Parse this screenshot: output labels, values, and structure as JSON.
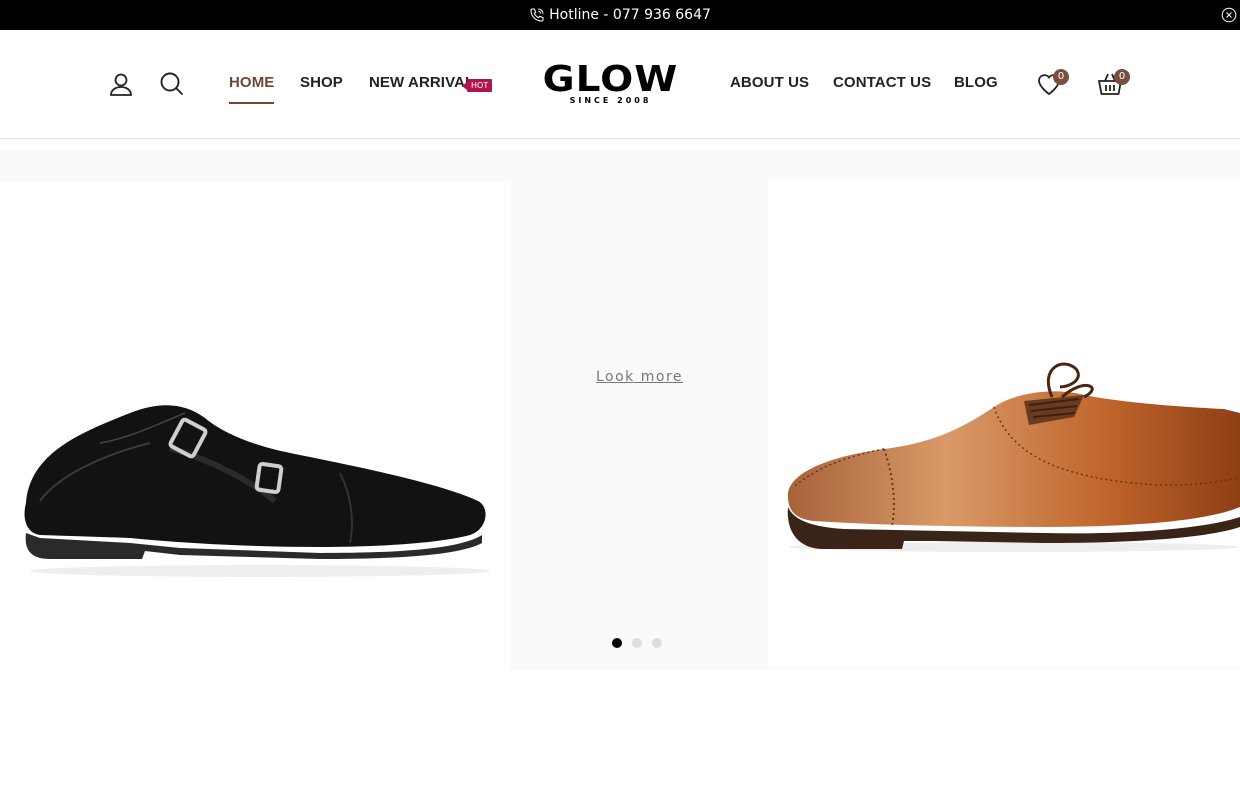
{
  "topbar": {
    "hotline_text": "Hotline - 077 936 6647",
    "phone_icon": "phone-icon",
    "close_icon": "close-circle-icon"
  },
  "header": {
    "icons_left": [
      "user-icon",
      "search-icon"
    ],
    "nav_left": [
      {
        "label": "HOME",
        "active": true
      },
      {
        "label": "SHOP"
      },
      {
        "label": "NEW ARRIVAL",
        "badge": "HOT"
      }
    ],
    "logo": {
      "word": "GLOW",
      "tagline": "SINCE 2008"
    },
    "nav_right": [
      {
        "label": "ABOUT US"
      },
      {
        "label": "CONTACT US"
      },
      {
        "label": "BLOG"
      }
    ],
    "wishlist": {
      "icon": "heart-icon",
      "count": "0"
    },
    "cart": {
      "icon": "basket-icon",
      "count": "0"
    }
  },
  "colors": {
    "accent": "#6d4636",
    "badge_hot": "#b0164c",
    "count_badge": "#7a4e3d",
    "topbar": "#000000"
  },
  "hero": {
    "left_image": "black-monk-strap-shoe",
    "right_image": "tan-oxford-cap-toe-shoe",
    "cta": "Look more",
    "slides": 3,
    "active_slide": 1
  }
}
